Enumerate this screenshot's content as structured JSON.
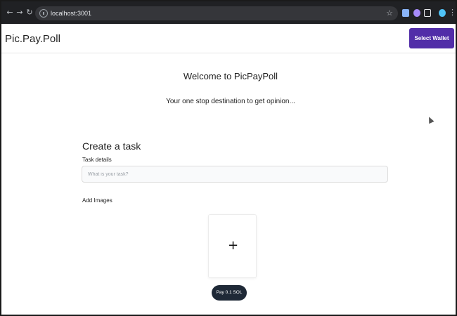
{
  "browser": {
    "url": "localhost:3001",
    "back_icon": "back-arrow-icon",
    "forward_icon": "forward-arrow-icon",
    "reload_icon": "reload-icon",
    "accent_colors": {
      "extension_1": "#8ab4f8",
      "extension_2": "#a78bfa",
      "extension_3": "#e8eaed",
      "profile": "#4fc3f7"
    }
  },
  "header": {
    "brand": "Pic.Pay.Poll",
    "wallet_button": "Select Wallet",
    "wallet_button_color": "#512da8"
  },
  "hero": {
    "title": "Welcome to PicPayPoll",
    "subtitle": "Your one stop destination to get opinion..."
  },
  "form": {
    "title": "Create a task",
    "task_label": "Task details",
    "task_placeholder": "What is your task?",
    "task_value": "",
    "images_label": "Add Images",
    "upload_symbol": "+",
    "pay_button": "Pay 0.1 SOL",
    "pay_button_color": "#1f2937"
  }
}
